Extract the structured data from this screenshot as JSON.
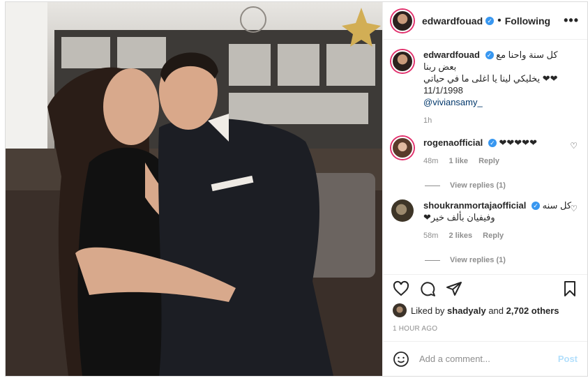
{
  "header": {
    "username": "edwardfouad",
    "separator": "•",
    "follow_status": "Following",
    "more": "•••"
  },
  "caption": {
    "username": "edwardfouad",
    "line1": "كل سنة واحنا مع بعض ربنا",
    "line2": "❤❤ يخليكي لينا يا اغلى ما في حياتي",
    "date": "11/1/1998",
    "mention": "@viviansamy_",
    "time": "1h"
  },
  "comments": [
    {
      "username": "rogenaofficial",
      "text": "❤❤❤❤❤",
      "time": "48m",
      "likes": "1 like",
      "reply": "Reply",
      "view_replies": "View replies (1)"
    },
    {
      "username": "shoukranmortajaofficial",
      "text1": "كل سنه",
      "text2": "وفيفيان بألف خير❤",
      "time": "58m",
      "likes": "2 likes",
      "reply": "Reply",
      "view_replies": "View replies (1)"
    }
  ],
  "likes": {
    "prefix": "Liked by",
    "user": "shadyaly",
    "conj": "and",
    "others": "2,702 others"
  },
  "time_ago": "1 HOUR AGO",
  "add_comment": {
    "placeholder": "Add a comment...",
    "post": "Post"
  },
  "colors": {
    "verified": "#3897f0",
    "post_disabled": "#b2dffc",
    "story_ring": "#e1306c"
  }
}
